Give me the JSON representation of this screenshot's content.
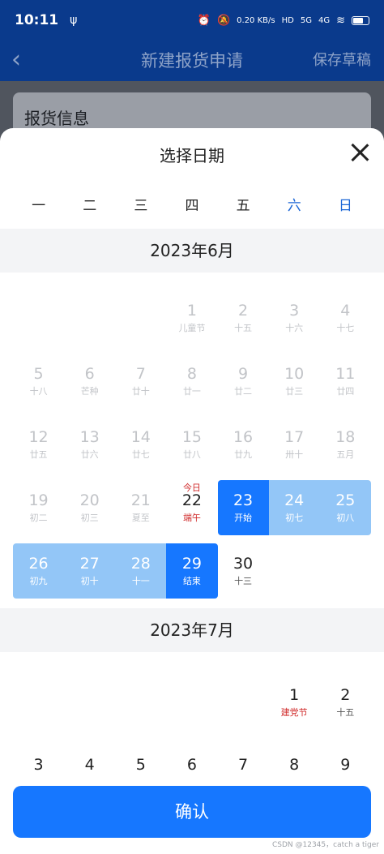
{
  "status_bar": {
    "time": "10:11",
    "net_speed": "0.20 KB/s",
    "hd": "HD",
    "signal1": "5G",
    "signal2": "4G"
  },
  "header": {
    "title": "新建报货申请",
    "action": "保存草稿"
  },
  "section": {
    "title": "报货信息"
  },
  "sheet": {
    "title": "选择日期"
  },
  "weekdays": [
    "一",
    "二",
    "三",
    "四",
    "五",
    "六",
    "日"
  ],
  "months": [
    {
      "title": "2023年6月",
      "days": [
        {
          "d": "1",
          "l": "儿童节"
        },
        {
          "d": "2",
          "l": "十五"
        },
        {
          "d": "3",
          "l": "十六"
        },
        {
          "d": "4",
          "l": "十七"
        },
        {
          "d": "5",
          "l": "十八"
        },
        {
          "d": "6",
          "l": "芒种"
        },
        {
          "d": "7",
          "l": "廿十"
        },
        {
          "d": "8",
          "l": "廿一"
        },
        {
          "d": "9",
          "l": "廿二"
        },
        {
          "d": "10",
          "l": "廿三"
        },
        {
          "d": "11",
          "l": "廿四"
        },
        {
          "d": "12",
          "l": "廿五"
        },
        {
          "d": "13",
          "l": "廿六"
        },
        {
          "d": "14",
          "l": "廿七"
        },
        {
          "d": "15",
          "l": "廿八"
        },
        {
          "d": "16",
          "l": "廿九"
        },
        {
          "d": "17",
          "l": "卅十"
        },
        {
          "d": "18",
          "l": "五月"
        },
        {
          "d": "19",
          "l": "初二"
        },
        {
          "d": "20",
          "l": "初三"
        },
        {
          "d": "21",
          "l": "夏至"
        },
        {
          "d": "22",
          "l": "端午",
          "top": "今日"
        },
        {
          "d": "23",
          "l": "开始"
        },
        {
          "d": "24",
          "l": "初七"
        },
        {
          "d": "25",
          "l": "初八"
        },
        {
          "d": "26",
          "l": "初九"
        },
        {
          "d": "27",
          "l": "初十"
        },
        {
          "d": "28",
          "l": "十一"
        },
        {
          "d": "29",
          "l": "结束"
        },
        {
          "d": "30",
          "l": "十三"
        }
      ]
    },
    {
      "title": "2023年7月",
      "days": [
        {
          "d": "1",
          "l": "建党节"
        },
        {
          "d": "2",
          "l": "十五"
        },
        {
          "d": "3",
          "l": ""
        },
        {
          "d": "4",
          "l": ""
        },
        {
          "d": "5",
          "l": ""
        },
        {
          "d": "6",
          "l": ""
        },
        {
          "d": "7",
          "l": ""
        },
        {
          "d": "8",
          "l": ""
        },
        {
          "d": "9",
          "l": ""
        }
      ]
    }
  ],
  "selection": {
    "start_label": "开始",
    "end_label": "结束",
    "today_label": "今日"
  },
  "footer": {
    "confirm_label": "确认"
  },
  "watermark": "CSDN @12345，catch a tiger",
  "colors": {
    "accent": "#1677ff",
    "range": "#93c6f7",
    "festival": "#d02b2b",
    "header_bg": "#0a3a8c"
  },
  "icons": {
    "back": "chevron-left-icon",
    "close": "close-icon"
  }
}
